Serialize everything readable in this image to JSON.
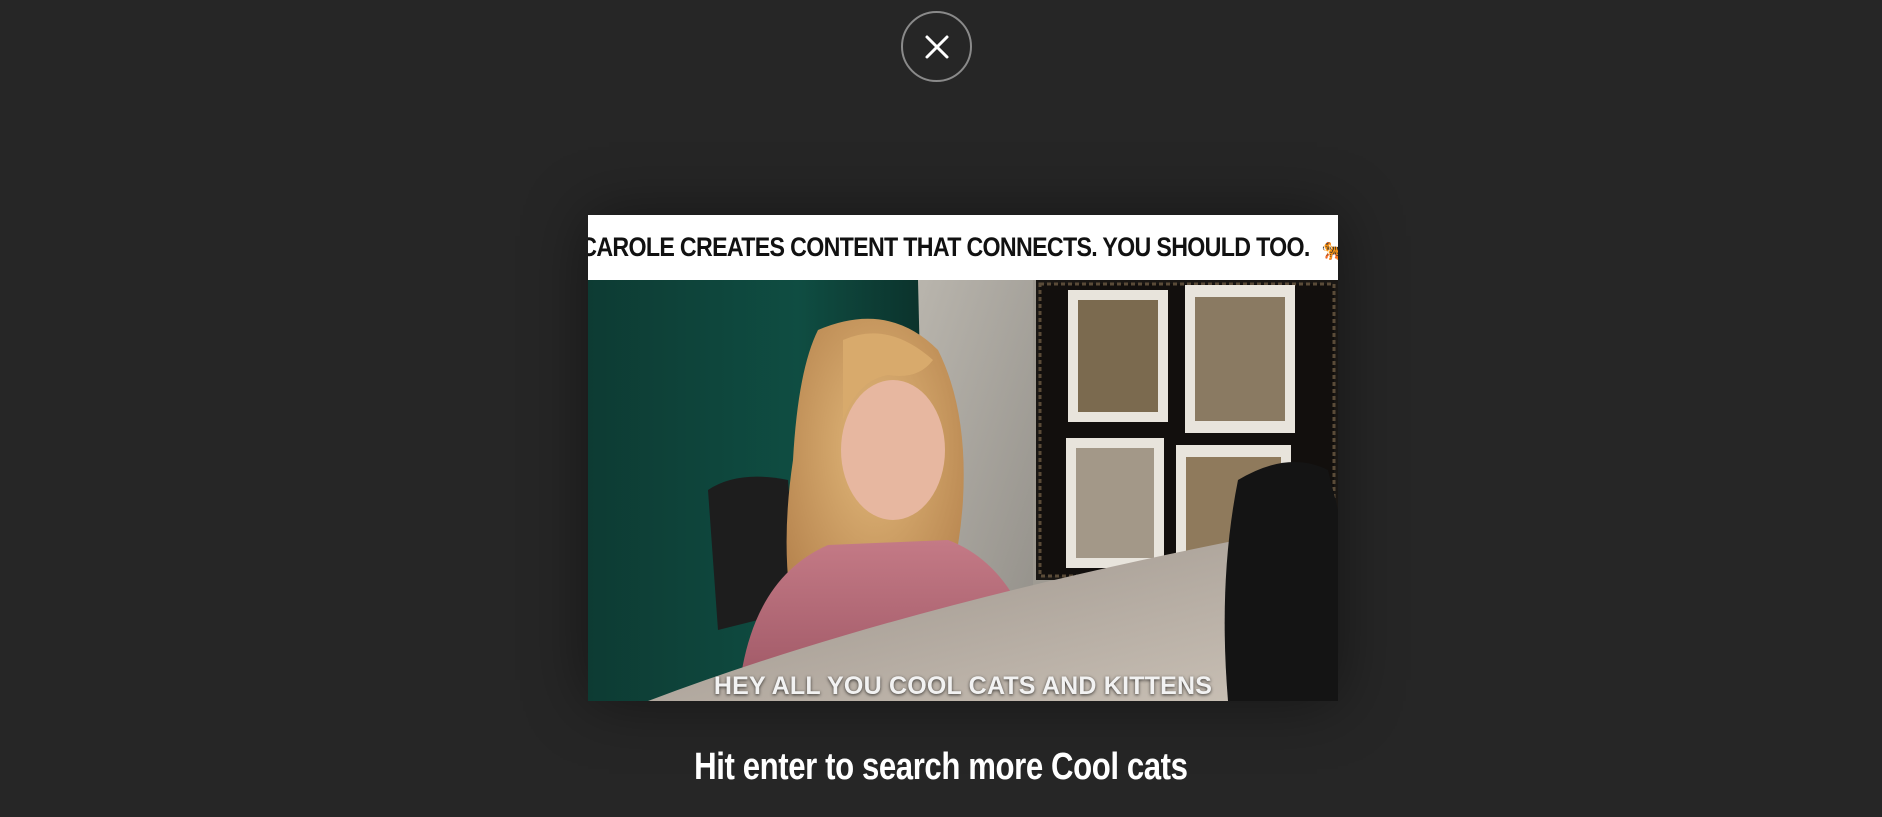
{
  "close": {
    "icon": "close-icon",
    "label": ""
  },
  "media": {
    "banner_text": "CAROLE CREATES CONTENT THAT CONNECTS. YOU SHOULD TOO.",
    "banner_emoji": "🐅",
    "caption": "HEY ALL YOU COOL CATS AND KITTENS"
  },
  "hint": {
    "text": "Hit enter to search more Cool cats"
  },
  "colors": {
    "background": "#262626",
    "banner": "#ffffff",
    "close_border": "#8a8a8a"
  }
}
